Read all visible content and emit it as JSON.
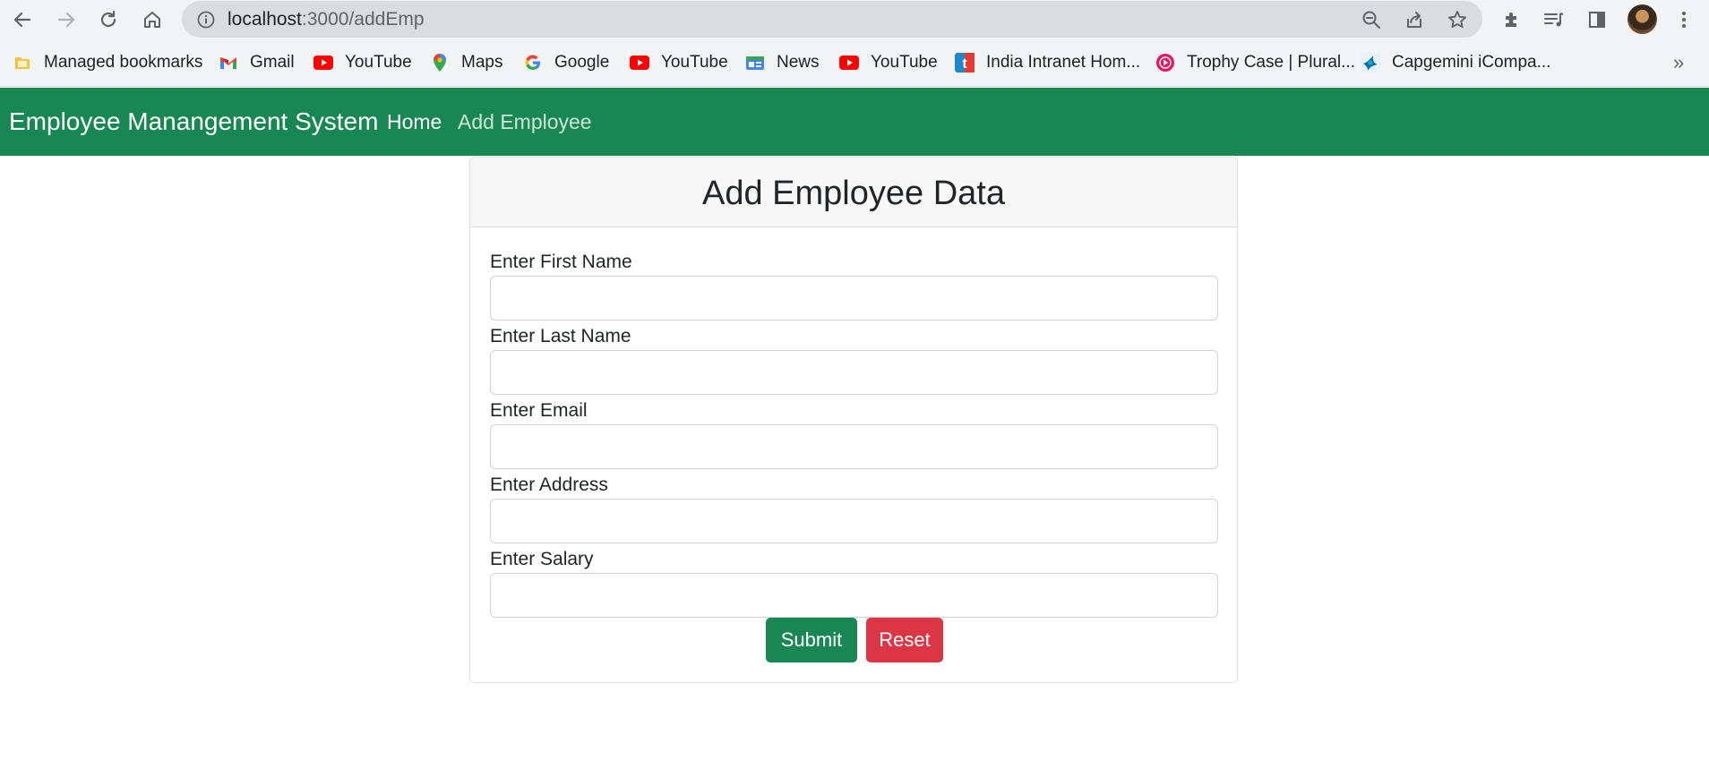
{
  "browser": {
    "url_host": "localhost",
    "url_path": ":3000/addEmp",
    "icons": [
      "back-arrow-icon",
      "forward-arrow-icon",
      "reload-icon",
      "home-icon",
      "info-icon",
      "zoom-icon",
      "share-icon",
      "star-icon",
      "extensions-icon",
      "reading-list-icon",
      "side-panel-icon",
      "menu-icon"
    ]
  },
  "bookmarks": {
    "items": [
      {
        "label": "Managed bookmarks",
        "icon": "folder-icon",
        "color": "#f6c33f"
      },
      {
        "label": "Gmail",
        "icon": "gmail-icon",
        "color": "#ea4335"
      },
      {
        "label": "YouTube",
        "icon": "youtube-icon",
        "color": "#ff0000"
      },
      {
        "label": "Maps",
        "icon": "maps-icon",
        "color": "#34a853"
      },
      {
        "label": "Google",
        "icon": "google-icon",
        "color": "#4285f4"
      },
      {
        "label": "YouTube",
        "icon": "youtube-icon",
        "color": "#ff0000"
      },
      {
        "label": "News",
        "icon": "news-icon",
        "color": "#4285f4"
      },
      {
        "label": "YouTube",
        "icon": "youtube-icon",
        "color": "#ff0000"
      },
      {
        "label": "India Intranet Hom...",
        "icon": "intranet-icon",
        "color": "#1e88c9"
      },
      {
        "label": "Trophy Case | Plural...",
        "icon": "pluralsight-icon",
        "color": "#e8175d"
      },
      {
        "label": "Capgemini iCompa...",
        "icon": "capgemini-icon",
        "color": "#0070ad"
      }
    ],
    "more": "»"
  },
  "navbar": {
    "brand": "Employee Manangement System",
    "home": "Home",
    "add_employee": "Add Employee",
    "color": "#198754"
  },
  "form": {
    "title": "Add Employee Data",
    "fields": [
      {
        "label": "Enter First Name",
        "value": ""
      },
      {
        "label": "Enter Last Name",
        "value": ""
      },
      {
        "label": "Enter Email",
        "value": ""
      },
      {
        "label": "Enter Address",
        "value": ""
      },
      {
        "label": "Enter Salary",
        "value": ""
      }
    ],
    "submit_label": "Submit",
    "reset_label": "Reset",
    "submit_color": "#198754",
    "reset_color": "#dc3545"
  }
}
